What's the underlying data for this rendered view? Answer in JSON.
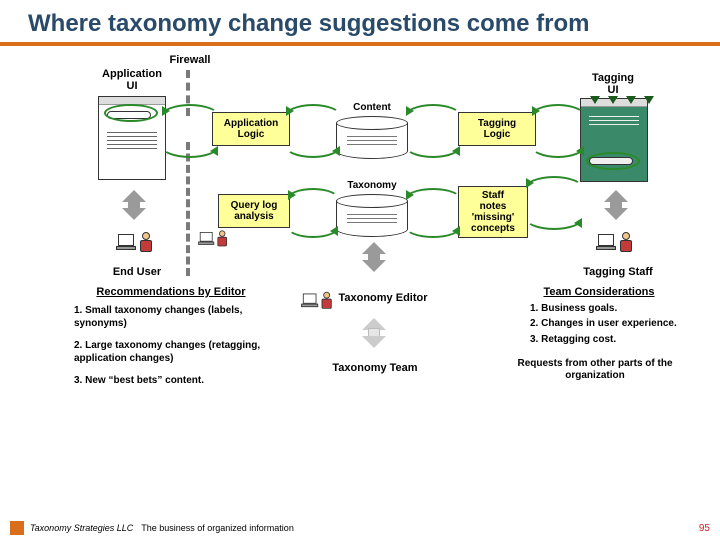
{
  "title": "Where taxonomy change suggestions come from",
  "labels": {
    "firewall": "Firewall",
    "app_ui": "Application\nUI",
    "tag_ui": "Tagging\nUI",
    "app_logic": "Application\nLogic",
    "tag_logic": "Tagging\nLogic",
    "content_db": "Content",
    "taxonomy_db": "Taxonomy",
    "query_log": "Query log\nanalysis",
    "staff_notes": "Staff\nnotes\n'missing'\nconcepts",
    "end_user": "End User",
    "tag_staff": "Tagging Staff",
    "tax_editor": "Taxonomy Editor",
    "tax_team": "Taxonomy Team"
  },
  "recs": {
    "heading": "Recommendations by Editor",
    "items": [
      "1. Small taxonomy changes (labels, synonyms)",
      "2. Large taxonomy changes (retagging, application changes)",
      "3. New “best bets” content."
    ]
  },
  "team": {
    "heading": "Team Considerations",
    "items": [
      "1. Business goals.",
      "2. Changes in user experience.",
      "3. Retagging cost."
    ],
    "requests": "Requests from other parts of the organization"
  },
  "footer": {
    "brand": "Taxonomy Strategies LLC",
    "tagline": "The business of organized information",
    "page": "95"
  }
}
